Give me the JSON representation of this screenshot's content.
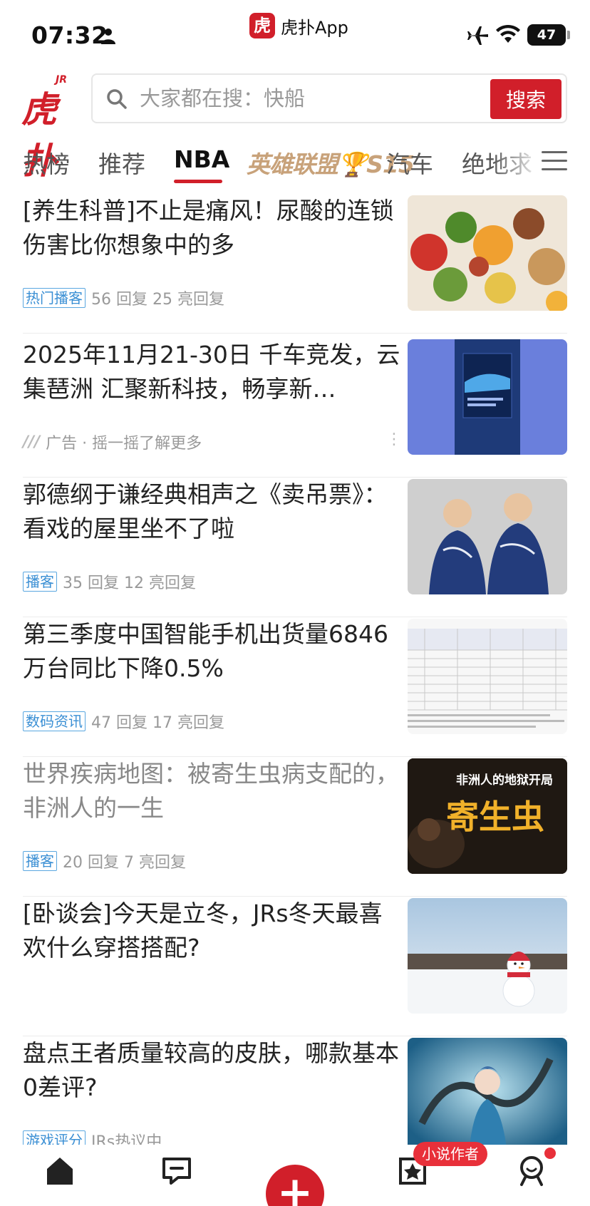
{
  "status_bar": {
    "time": "07:32",
    "app_name": "虎扑App",
    "app_logo_char": "虎",
    "battery": "47"
  },
  "header": {
    "logo_text": "虎扑",
    "logo_jr": "JR",
    "search_placeholder": "大家都在搜：快船",
    "search_button": "搜索"
  },
  "tabs": [
    {
      "label": "热榜"
    },
    {
      "label": "推荐"
    },
    {
      "label": "NBA",
      "active": true
    },
    {
      "label": "英雄联盟🏆S15"
    },
    {
      "label": "汽车"
    },
    {
      "label": "绝地求"
    }
  ],
  "feed": [
    {
      "title": "[养生科普]不止是痛风！尿酸的连锁伤害比你想象中的多",
      "tag": "热门播客",
      "replies": "56 回复",
      "bright": "25 亮回复"
    },
    {
      "title": "2025年11月21-30日 千车竞发，云集琶洲 汇聚新科技，畅享新…",
      "ad_label": "广告 · 摇一摇了解更多",
      "ad_more": "⋮"
    },
    {
      "title": "郭德纲于谦经典相声之《卖吊票》：看戏的屋里坐不了啦",
      "tag": "播客",
      "replies": "35 回复",
      "bright": "12 亮回复"
    },
    {
      "title": "第三季度中国智能手机出货量6846万台同比下降0.5%",
      "tag": "数码资讯",
      "replies": "47 回复",
      "bright": "17 亮回复"
    },
    {
      "title": "世界疾病地图：被寄生虫病支配的，非洲人的一生",
      "tag": "播客",
      "replies": "20 回复",
      "bright": "7 亮回复",
      "thumb_text_top": "非洲人的地狱开局",
      "thumb_text_main": "寄生虫"
    },
    {
      "title": "[卧谈会]今天是立冬，JRs冬天最喜欢什么穿搭搭配?"
    },
    {
      "title": "盘点王者质量较高的皮肤，哪款基本0差评?",
      "tag": "游戏评分",
      "meta_text": "JRs热议中"
    }
  ],
  "bottom_nav": {
    "plus": "+",
    "badge": "小说作者"
  },
  "colors": {
    "brand_red": "#d11f2a",
    "tag_blue": "#3a8fd4"
  }
}
